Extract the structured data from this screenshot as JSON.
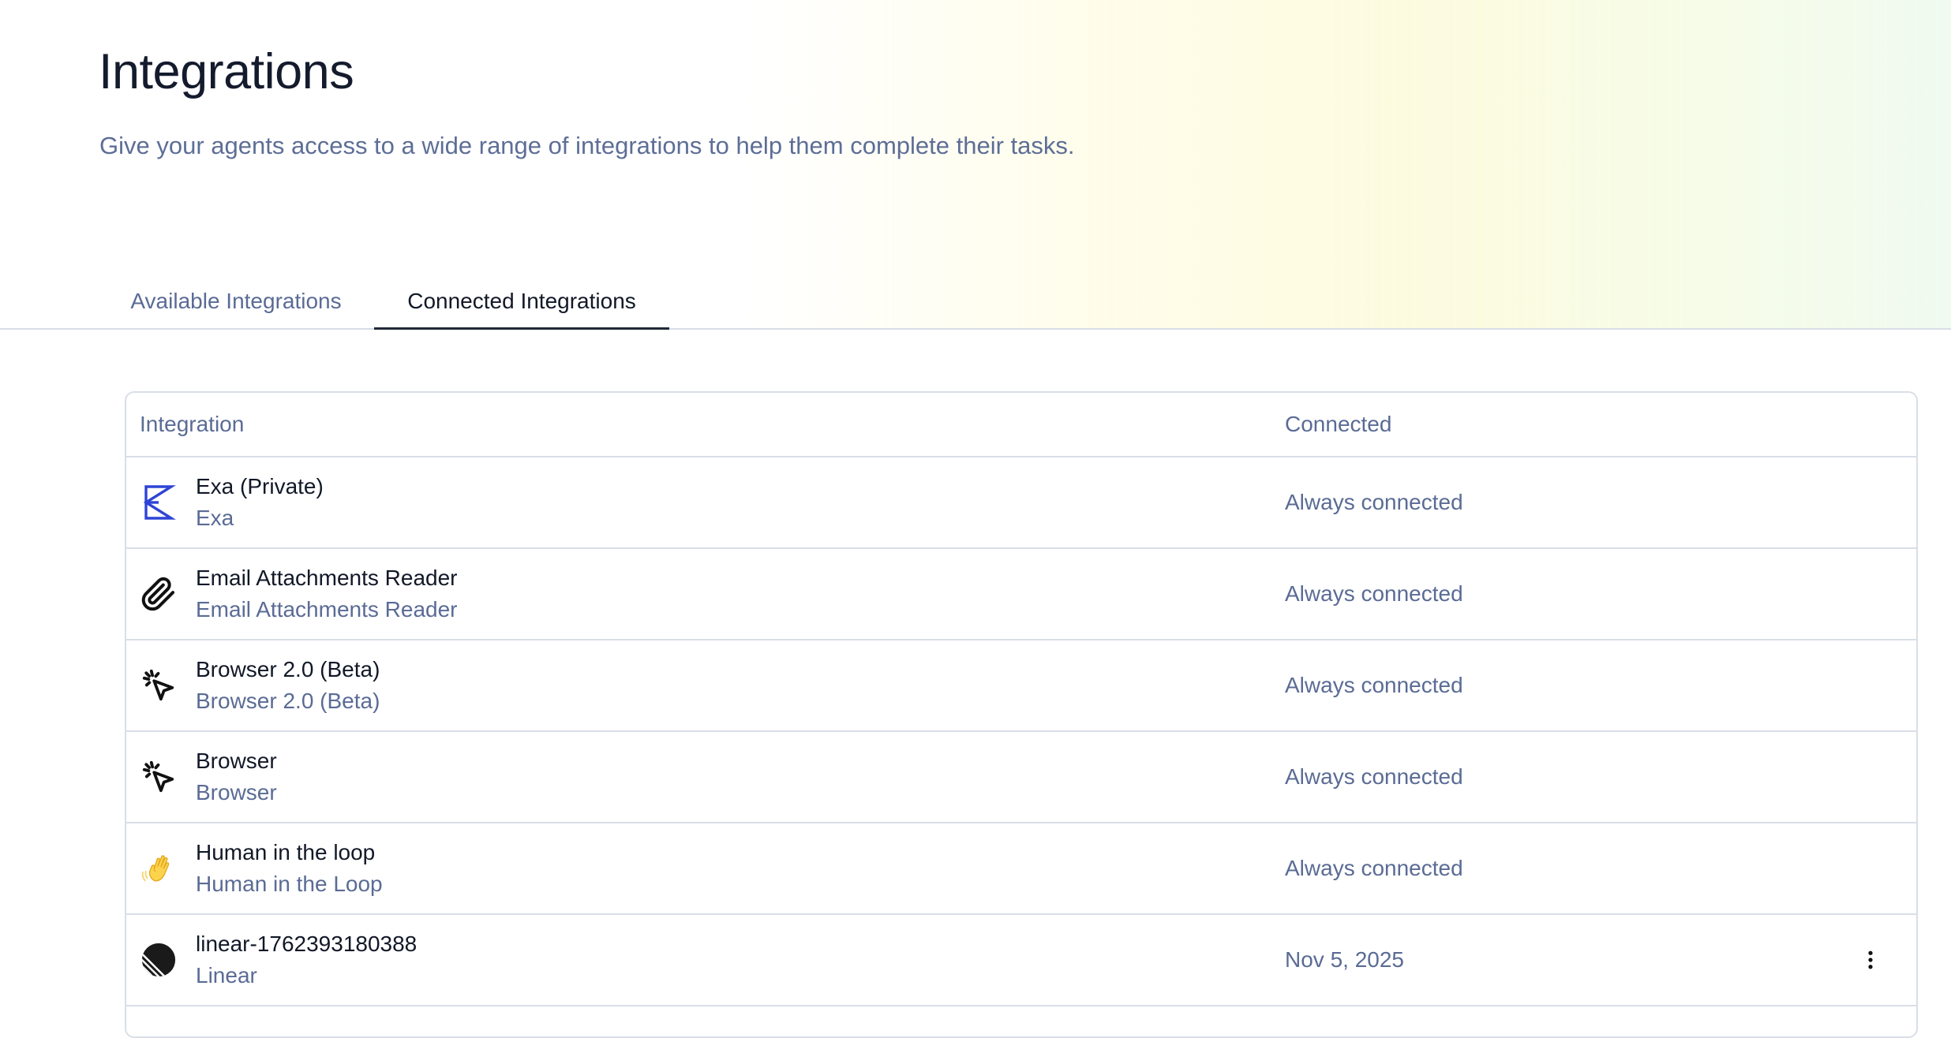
{
  "header": {
    "title": "Integrations",
    "subtitle": "Give your agents access to a wide range of integrations to help them complete their tasks."
  },
  "tabs": [
    {
      "label": "Available Integrations",
      "active": false
    },
    {
      "label": "Connected Integrations",
      "active": true
    }
  ],
  "table": {
    "columns": {
      "integration": "Integration",
      "connected": "Connected"
    },
    "rows": [
      {
        "icon": "exa-logo-icon",
        "name": "Exa (Private)",
        "provider": "Exa",
        "connected": "Always connected",
        "has_menu": false
      },
      {
        "icon": "paperclip-icon",
        "name": "Email Attachments Reader",
        "provider": "Email Attachments Reader",
        "connected": "Always connected",
        "has_menu": false
      },
      {
        "icon": "cursor-click-icon",
        "name": "Browser 2.0 (Beta)",
        "provider": "Browser 2.0 (Beta)",
        "connected": "Always connected",
        "has_menu": false
      },
      {
        "icon": "cursor-click-icon",
        "name": "Browser",
        "provider": "Browser",
        "connected": "Always connected",
        "has_menu": false
      },
      {
        "icon": "waving-hand-icon",
        "name": "Human in the loop",
        "provider": "Human in the Loop",
        "connected": "Always connected",
        "has_menu": false
      },
      {
        "icon": "linear-logo-icon",
        "name": "linear-1762393180388",
        "provider": "Linear",
        "connected": "Nov 5, 2025",
        "has_menu": true
      }
    ]
  },
  "colors": {
    "title": "#141b2d",
    "muted_text": "#5a6b95",
    "border": "#d9dee7",
    "exa_blue": "#2e44d6",
    "active_tab_underline": "#1f2937"
  }
}
